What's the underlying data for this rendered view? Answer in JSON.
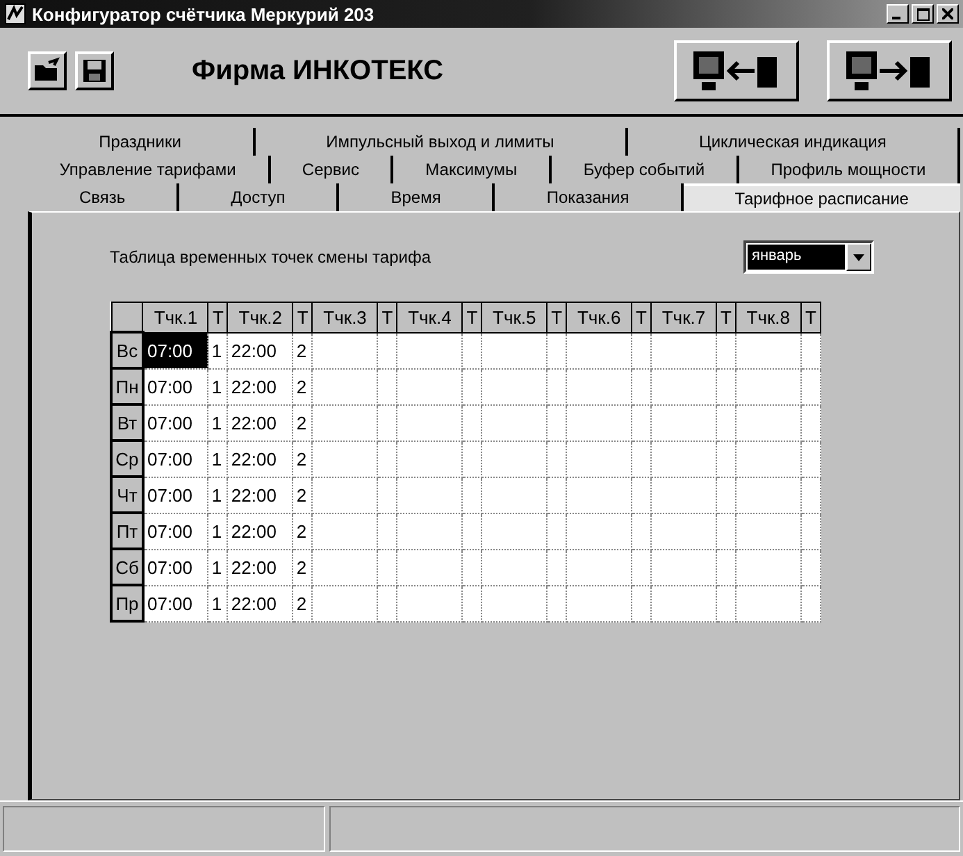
{
  "window": {
    "title": "Конфигуратор счётчика Меркурий 203"
  },
  "toolbar": {
    "brand": "Фирма ИНКОТЕКС"
  },
  "tab_rows": [
    [
      {
        "label": "Праздники",
        "selected": false
      },
      {
        "label": "Импульсный выход и лимиты",
        "selected": false
      },
      {
        "label": "Циклическая индикация",
        "selected": false
      }
    ],
    [
      {
        "label": "Управление тарифами",
        "selected": false
      },
      {
        "label": "Сервис",
        "selected": false
      },
      {
        "label": "Максимумы",
        "selected": false
      },
      {
        "label": "Буфер событий",
        "selected": false
      },
      {
        "label": "Профиль мощности",
        "selected": false
      }
    ],
    [
      {
        "label": "Связь",
        "selected": false
      },
      {
        "label": "Доступ",
        "selected": false
      },
      {
        "label": "Время",
        "selected": false
      },
      {
        "label": "Показания",
        "selected": false
      },
      {
        "label": "Тарифное расписание",
        "selected": true
      }
    ]
  ],
  "panel": {
    "caption": "Таблица временных точек смены тарифа",
    "month": "январь"
  },
  "table": {
    "columns": [
      "Тчк.1",
      "Т",
      "Тчк.2",
      "Т",
      "Тчк.3",
      "Т",
      "Тчк.4",
      "Т",
      "Тчк.5",
      "Т",
      "Тчк.6",
      "Т",
      "Тчк.7",
      "Т",
      "Тчк.8",
      "Т"
    ],
    "rows": [
      {
        "day": "Вс",
        "points": [
          {
            "time": "07:00",
            "tariff": "1",
            "selected": true
          },
          {
            "time": "22:00",
            "tariff": "2",
            "selected": false
          }
        ]
      },
      {
        "day": "Пн",
        "points": [
          {
            "time": "07:00",
            "tariff": "1",
            "selected": false
          },
          {
            "time": "22:00",
            "tariff": "2",
            "selected": false
          }
        ]
      },
      {
        "day": "Вт",
        "points": [
          {
            "time": "07:00",
            "tariff": "1",
            "selected": false
          },
          {
            "time": "22:00",
            "tariff": "2",
            "selected": false
          }
        ]
      },
      {
        "day": "Ср",
        "points": [
          {
            "time": "07:00",
            "tariff": "1",
            "selected": false
          },
          {
            "time": "22:00",
            "tariff": "2",
            "selected": false
          }
        ]
      },
      {
        "day": "Чт",
        "points": [
          {
            "time": "07:00",
            "tariff": "1",
            "selected": false
          },
          {
            "time": "22:00",
            "tariff": "2",
            "selected": false
          }
        ]
      },
      {
        "day": "Пт",
        "points": [
          {
            "time": "07:00",
            "tariff": "1",
            "selected": false
          },
          {
            "time": "22:00",
            "tariff": "2",
            "selected": false
          }
        ]
      },
      {
        "day": "Сб",
        "points": [
          {
            "time": "07:00",
            "tariff": "1",
            "selected": false
          },
          {
            "time": "22:00",
            "tariff": "2",
            "selected": false
          }
        ]
      },
      {
        "day": "Пр",
        "points": [
          {
            "time": "07:00",
            "tariff": "1",
            "selected": false
          },
          {
            "time": "22:00",
            "tariff": "2",
            "selected": false
          }
        ]
      }
    ]
  }
}
